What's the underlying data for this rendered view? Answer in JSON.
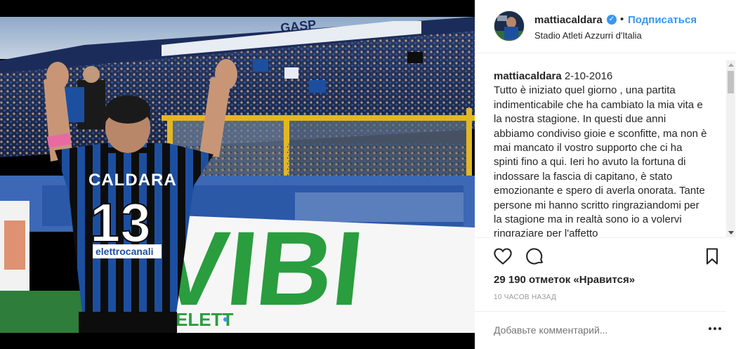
{
  "header": {
    "username": "mattiacaldara",
    "verified_icon": "verified-badge-icon",
    "separator": "•",
    "follow_label": "Подписаться",
    "location": "Stadio Atleti Azzurri d'Italia"
  },
  "caption": {
    "username": "mattiacaldara",
    "date": "2-10-2016",
    "text": "Tutto è iniziato quel giorno , una partita indimenticabile che ha cambiato la mia vita e la nostra stagione. In questi due anni abbiamo condiviso gioie e sconfitte, ma non è mai mancato il vostro supporto che ci ha spinti fino a qui. Ieri ho avuto la fortuna di indossare la fascia di capitano, è stato emozionante e spero di averla onorata. Tante persone mi hanno scritto ringraziandomi per la stagione ma in realtà sono io a volervi ringraziare per l'affetto"
  },
  "photo": {
    "jersey_name": "CALDARA",
    "jersey_number": "13",
    "sponsor": "elettrocanali",
    "banner_text": "VIBI",
    "banner_sub": "ELETT",
    "stand_banner": "GASP"
  },
  "actions": {
    "icons": [
      "heart-icon",
      "comment-icon",
      "bookmark-icon"
    ]
  },
  "likes": "29 190 отметок «Нравится»",
  "time_ago": "10 ЧАСОВ НАЗАД",
  "comment_box": {
    "placeholder": "Добавьте комментарий..."
  },
  "colors": {
    "accent": "#3897f0",
    "text": "#262626",
    "muted": "#999999",
    "atalanta_blue": "#1d4fa0",
    "atalanta_black": "#0d0d0d",
    "banner_green": "#2a9d3e"
  }
}
